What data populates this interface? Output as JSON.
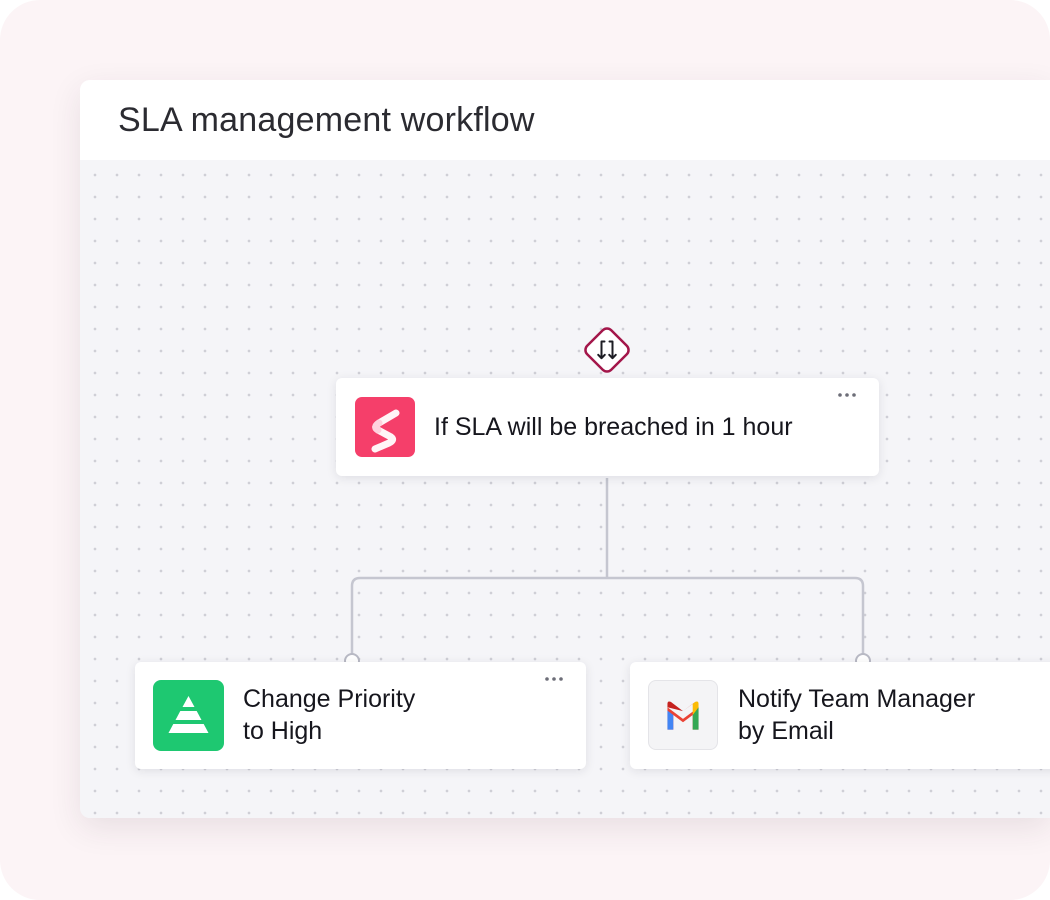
{
  "window": {
    "title": "SLA management workflow"
  },
  "trigger": {
    "icon": "branch-arrows-icon",
    "label": "If SLA will be breached in 1 hour",
    "app_icon": "sla-app-icon",
    "app_color": "#f53f6a"
  },
  "actions": [
    {
      "label_line1": "Change Priority",
      "label_line2": "to High",
      "app_icon": "priority-pyramid-icon",
      "app_color": "#1ec871"
    },
    {
      "label_line1": "Notify Team Manager",
      "label_line2": "by Email",
      "app_icon": "gmail-icon",
      "app_color": "#f4f4f6"
    }
  ],
  "menu_icon": "more-horizontal-icon",
  "colors": {
    "accent_diamond": "#a3164a",
    "connector": "#c5c6d0",
    "canvas": "#f5f5f8"
  }
}
